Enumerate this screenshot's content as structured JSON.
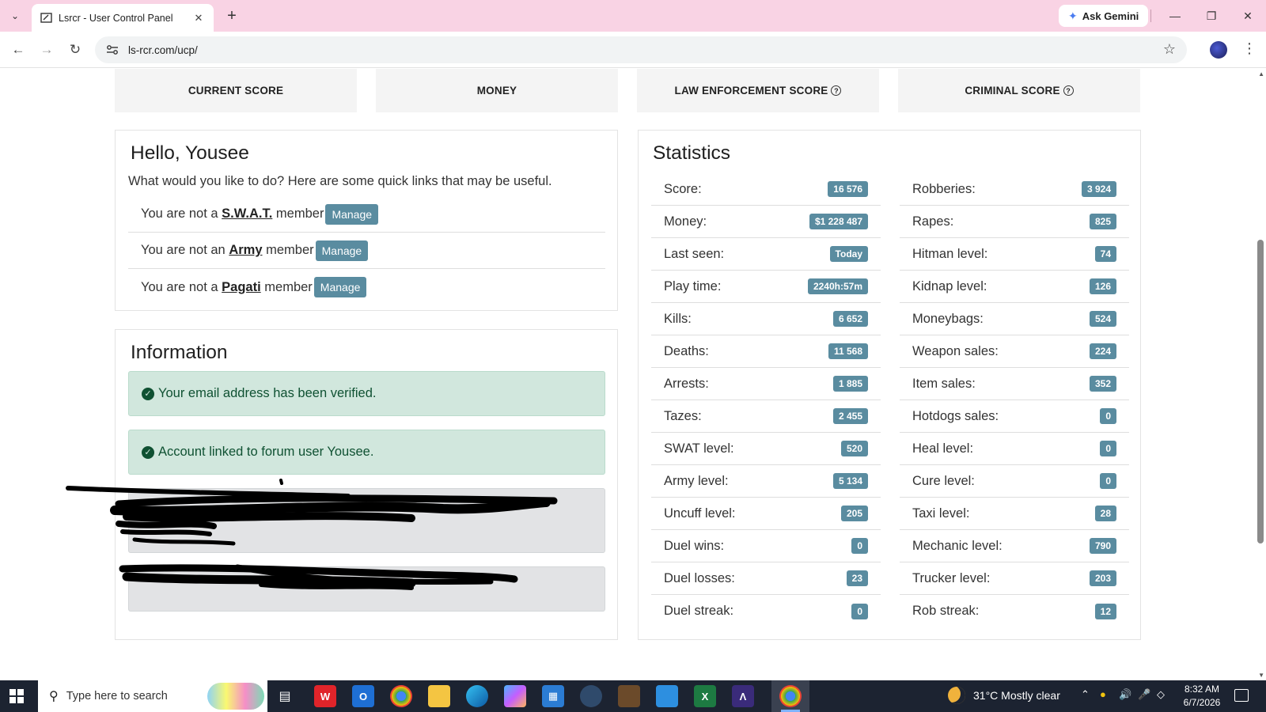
{
  "browser": {
    "tab_title": "Lsrcr - User Control Panel",
    "url": "ls-rcr.com/ucp/",
    "ask_gemini": "Ask Gemini"
  },
  "score_cards": [
    {
      "label": "CURRENT SCORE",
      "help": false
    },
    {
      "label": "MONEY",
      "help": false
    },
    {
      "label": "LAW ENFORCEMENT SCORE",
      "help": true
    },
    {
      "label": "CRIMINAL SCORE",
      "help": true
    }
  ],
  "hello": {
    "title": "Hello, Yousee",
    "subtitle": "What would you like to do? Here are some quick links that may be useful.",
    "memberships": [
      {
        "prefix": "You are not a",
        "group": "S.W.A.T.",
        "suffix": "member",
        "button": "Manage"
      },
      {
        "prefix": "You are not an",
        "group": "Army",
        "suffix": "member",
        "button": "Manage"
      },
      {
        "prefix": "You are not a",
        "group": "Pagati",
        "suffix": "member",
        "button": "Manage"
      }
    ]
  },
  "information": {
    "title": "Information",
    "alerts": [
      "Your email address has been verified.",
      "Account linked to forum user Yousee."
    ]
  },
  "statistics": {
    "title": "Statistics",
    "left": [
      {
        "label": "Score:",
        "value": "16 576"
      },
      {
        "label": "Money:",
        "value": "$1 228 487"
      },
      {
        "label": "Last seen:",
        "value": "Today"
      },
      {
        "label": "Play time:",
        "value": "2240h:57m"
      },
      {
        "label": "Kills:",
        "value": "6 652"
      },
      {
        "label": "Deaths:",
        "value": "11 568"
      },
      {
        "label": "Arrests:",
        "value": "1 885"
      },
      {
        "label": "Tazes:",
        "value": "2 455"
      },
      {
        "label": "SWAT level:",
        "value": "520"
      },
      {
        "label": "Army level:",
        "value": "5 134"
      },
      {
        "label": "Uncuff level:",
        "value": "205"
      },
      {
        "label": "Duel wins:",
        "value": "0"
      },
      {
        "label": "Duel losses:",
        "value": "23"
      },
      {
        "label": "Duel streak:",
        "value": "0"
      }
    ],
    "right": [
      {
        "label": "Robberies:",
        "value": "3 924"
      },
      {
        "label": "Rapes:",
        "value": "825"
      },
      {
        "label": "Hitman level:",
        "value": "74"
      },
      {
        "label": "Kidnap level:",
        "value": "126"
      },
      {
        "label": "Moneybags:",
        "value": "524"
      },
      {
        "label": "Weapon sales:",
        "value": "224"
      },
      {
        "label": "Item sales:",
        "value": "352"
      },
      {
        "label": "Hotdogs sales:",
        "value": "0"
      },
      {
        "label": "Heal level:",
        "value": "0"
      },
      {
        "label": "Cure level:",
        "value": "0"
      },
      {
        "label": "Taxi level:",
        "value": "28"
      },
      {
        "label": "Mechanic level:",
        "value": "790"
      },
      {
        "label": "Trucker level:",
        "value": "203"
      },
      {
        "label": "Rob streak:",
        "value": "12"
      }
    ]
  },
  "taskbar": {
    "search_placeholder": "Type here to search",
    "weather": "31°C  Mostly clear",
    "time": "8:32 AM",
    "date": "6/7/2026"
  },
  "colors": {
    "tab_strip": "#f9d3e4",
    "badge": "#5a8ca0",
    "alert_bg": "#d1e7dd",
    "taskbar": "#1c2331"
  }
}
